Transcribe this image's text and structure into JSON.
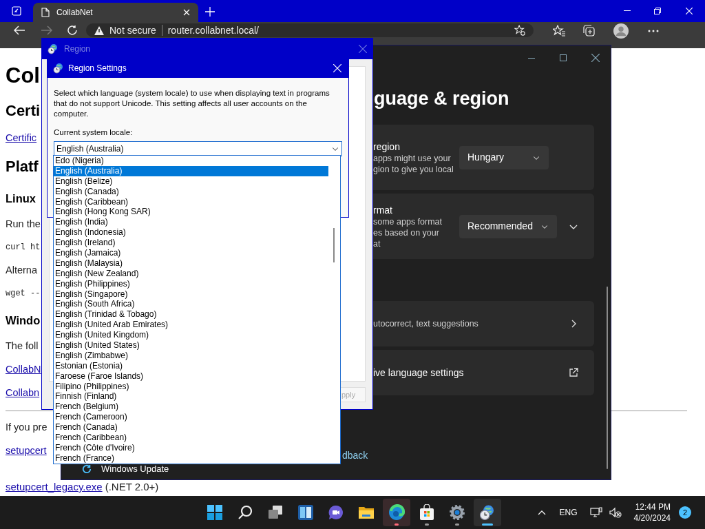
{
  "browser": {
    "tab": {
      "title": "CollabNet"
    },
    "security": "Not secure",
    "address": "router.collabnet.local/"
  },
  "page": {
    "items": [
      {
        "kind": "h1",
        "text": "Col"
      },
      {
        "kind": "h2",
        "text": "Certi"
      },
      {
        "kind": "link",
        "text": "Certific"
      },
      {
        "kind": "h2",
        "text": "Platf"
      },
      {
        "kind": "h3",
        "text": "Linux"
      },
      {
        "kind": "p",
        "text": "Run the"
      },
      {
        "kind": "code",
        "text": "curl ht"
      },
      {
        "kind": "p",
        "text": "Alterna"
      },
      {
        "kind": "code",
        "text": "wget --"
      },
      {
        "kind": "h3",
        "text": "Windo"
      },
      {
        "kind": "p",
        "text": "The foll"
      },
      {
        "kind": "link",
        "text": "CollabN"
      },
      {
        "kind": "link",
        "text": "Collabn"
      },
      {
        "kind": "rule"
      },
      {
        "kind": "p",
        "text": "If you pre"
      },
      {
        "kind": "link",
        "text": "setupcert"
      },
      {
        "kind": "link_note",
        "text": "setupcert_legacy.exe",
        "note": "(.NET 2.0+)"
      }
    ]
  },
  "settings_window": {
    "title": "guage & region",
    "nav_item": "Windows Update",
    "feedback_link": "dback",
    "cards": [
      {
        "kind": "dropdown",
        "title": "region",
        "lines": [
          "apps might use your",
          "gion to give you local"
        ],
        "value": "Hungary"
      },
      {
        "kind": "dropdown_expand",
        "title": "rmat",
        "lines": [
          "some apps format",
          "es based on your",
          "at"
        ],
        "value": "Recommended"
      },
      {
        "kind": "link",
        "lines": [
          "utocorrect, text suggestions"
        ]
      },
      {
        "kind": "external",
        "title": "ive language settings"
      }
    ]
  },
  "region_window": {
    "title": "Region",
    "apply_button": "pply"
  },
  "region_settings": {
    "title": "Region Settings",
    "description": "Select which language (system locale) to use when displaying text in programs that do not support Unicode. This setting affects all user accounts on the computer.",
    "locale_label": "Current system locale:",
    "locale_value": "English (Australia)",
    "options": [
      {
        "label": "Edo (Nigeria)",
        "selected": false
      },
      {
        "label": "English (Australia)",
        "selected": true
      },
      {
        "label": "English (Belize)",
        "selected": false
      },
      {
        "label": "English (Canada)",
        "selected": false
      },
      {
        "label": "English (Caribbean)",
        "selected": false
      },
      {
        "label": "English (Hong Kong SAR)",
        "selected": false
      },
      {
        "label": "English (India)",
        "selected": false
      },
      {
        "label": "English (Indonesia)",
        "selected": false
      },
      {
        "label": "English (Ireland)",
        "selected": false
      },
      {
        "label": "English (Jamaica)",
        "selected": false
      },
      {
        "label": "English (Malaysia)",
        "selected": false
      },
      {
        "label": "English (New Zealand)",
        "selected": false
      },
      {
        "label": "English (Philippines)",
        "selected": false
      },
      {
        "label": "English (Singapore)",
        "selected": false
      },
      {
        "label": "English (South Africa)",
        "selected": false
      },
      {
        "label": "English (Trinidad & Tobago)",
        "selected": false
      },
      {
        "label": "English (United Arab Emirates)",
        "selected": false
      },
      {
        "label": "English (United Kingdom)",
        "selected": false
      },
      {
        "label": "English (United States)",
        "selected": false
      },
      {
        "label": "English (Zimbabwe)",
        "selected": false
      },
      {
        "label": "Estonian (Estonia)",
        "selected": false
      },
      {
        "label": "Faroese (Faroe Islands)",
        "selected": false
      },
      {
        "label": "Filipino (Philippines)",
        "selected": false
      },
      {
        "label": "Finnish (Finland)",
        "selected": false
      },
      {
        "label": "French (Belgium)",
        "selected": false
      },
      {
        "label": "French (Cameroon)",
        "selected": false
      },
      {
        "label": "French (Canada)",
        "selected": false
      },
      {
        "label": "French (Caribbean)",
        "selected": false
      },
      {
        "label": "French (Côte d'Ivoire)",
        "selected": false
      },
      {
        "label": "French (France)",
        "selected": false
      }
    ]
  },
  "taskbar": {
    "apps": [
      {
        "kind": "start",
        "running": false,
        "active": false,
        "attention": false
      },
      {
        "kind": "search",
        "running": false,
        "active": false,
        "attention": false
      },
      {
        "kind": "taskview",
        "running": false,
        "active": false,
        "attention": false
      },
      {
        "kind": "widgets",
        "running": false,
        "active": false,
        "attention": false
      },
      {
        "kind": "chat",
        "running": false,
        "active": false,
        "attention": false
      },
      {
        "kind": "explorer",
        "running": false,
        "active": false,
        "attention": false
      },
      {
        "kind": "edge",
        "running": true,
        "active": false,
        "attention": true
      },
      {
        "kind": "store",
        "running": true,
        "active": false,
        "attention": false
      },
      {
        "kind": "settings",
        "running": true,
        "active": false,
        "attention": false
      },
      {
        "kind": "region",
        "running": true,
        "active": true,
        "attention": false
      }
    ],
    "language": "ENG",
    "time": "12:44 PM",
    "date": "4/20/2024",
    "notifications": "2"
  }
}
